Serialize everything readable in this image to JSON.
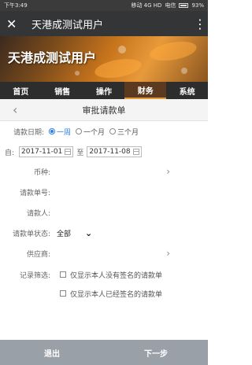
{
  "status_bar": {
    "time": "下午3:49",
    "network": "移动 4G HD",
    "carrier": "电信",
    "battery": "93%"
  },
  "app_bar": {
    "title": "天港成测试用户"
  },
  "banner": {
    "title": "天港成测试用户"
  },
  "nav": {
    "items": [
      "首页",
      "销售",
      "操作",
      "财务",
      "系统"
    ],
    "active": "财务"
  },
  "page": {
    "title": "审批请款单"
  },
  "form": {
    "date_label": "请款日期:",
    "date_options": [
      "一周",
      "一个月",
      "三个月"
    ],
    "date_selected": "一周",
    "from_label": "自:",
    "from_date": "2017-11-01",
    "to_label": "至",
    "to_date": "2017-11-08",
    "currency_label": "币种:",
    "request_no_label": "请款单号:",
    "requester_label": "请款人:",
    "status_label": "请款单状态:",
    "status_value": "全部",
    "supplier_label": "供应商:",
    "filter_label": "记录筛选:",
    "filter_option_1": "仅显示本人没有签名的请款单",
    "filter_option_2": "仅显示本人已经签名的请款单"
  },
  "footer": {
    "exit_label": "退出",
    "next_label": "下一步"
  },
  "colors": {
    "accent": "#2b7de9",
    "nav_active": "#e49a3a",
    "footer_bg": "#9aa0a8"
  }
}
